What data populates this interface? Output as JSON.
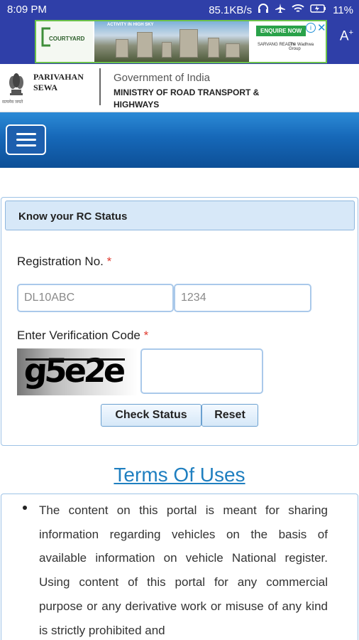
{
  "status_bar": {
    "time": "8:09 PM",
    "network_speed": "85.1KB/s",
    "battery": "11%"
  },
  "ad": {
    "brand": "COURTYARD",
    "tagline": "ACTIVITY IN HIGH SKY",
    "enquire_label": "ENQUIRE NOW",
    "partner1": "SARVANG REALTY",
    "partner2": "The Wadhwa Group"
  },
  "accessibility": {
    "font_size_label": "A",
    "font_size_sup": "+"
  },
  "header": {
    "logo_title_line1": "PARIVAHAN",
    "logo_title_line2": "SEWA",
    "emblem_caption": "सत्यमेव जयते",
    "gov": "Government of India",
    "ministry": "MINISTRY OF ROAD TRANSPORT & HIGHWAYS"
  },
  "rc_form": {
    "heading": "Know your RC Status",
    "registration_label": "Registration No.",
    "required_mark": "*",
    "reg_part1_placeholder": "DL10ABC",
    "reg_part2_placeholder": "1234",
    "verification_label": "Enter Verification Code",
    "captcha_text": "g5e2e",
    "check_status_label": "Check Status",
    "reset_label": "Reset"
  },
  "terms": {
    "title": "Terms Of Uses",
    "text": "The content on this portal is meant for sharing information regarding vehicles on the basis of available information on vehicle National register. Using content of this portal for any commercial purpose or any derivative work or misuse of any kind is strictly prohibited and"
  },
  "colors": {
    "status_bar": "#2f3fa8",
    "nav_gradient_top": "#2c8ad6",
    "nav_gradient_bottom": "#0d4f97",
    "link_blue": "#1f7fc0",
    "required_red": "#e03a2f"
  }
}
